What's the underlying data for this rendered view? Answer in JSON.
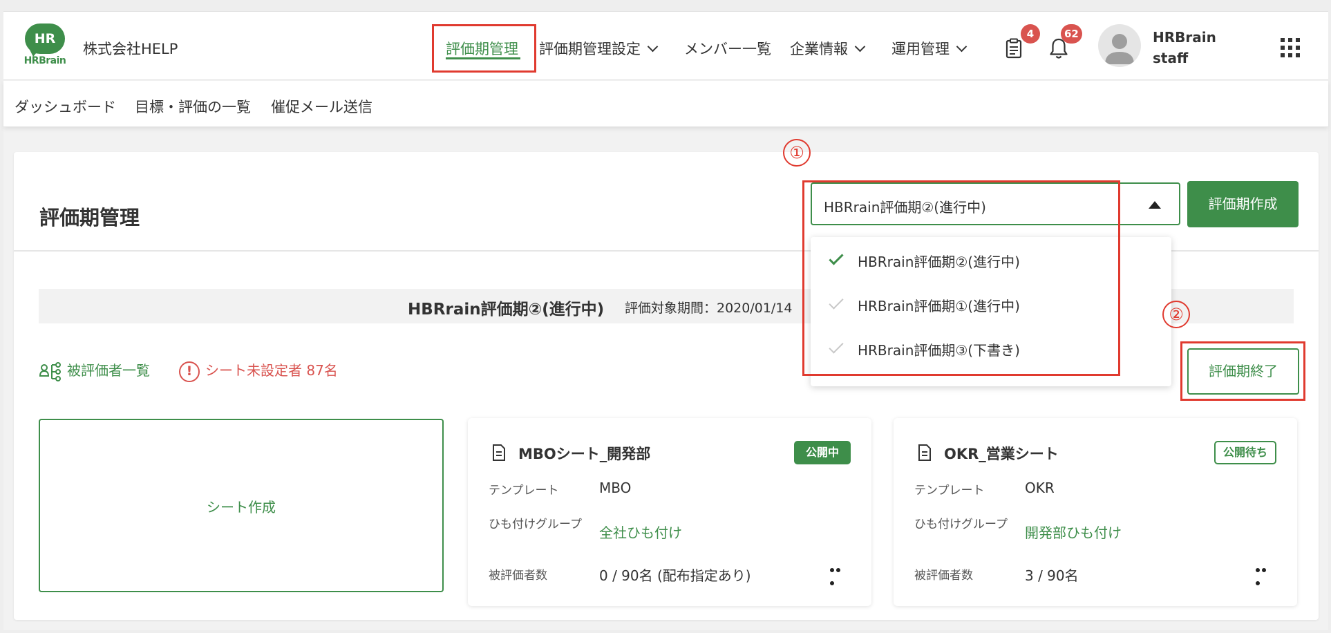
{
  "header": {
    "logo_mark": "HR",
    "logo_text": "HRBrain",
    "company": "株式会社HELP",
    "nav": [
      {
        "label": "評価期管理",
        "active": true
      },
      {
        "label": "評価期管理設定",
        "dropdown": true
      },
      {
        "label": "メンバー一覧"
      },
      {
        "label": "企業情報",
        "dropdown": true
      },
      {
        "label": "運用管理",
        "dropdown": true
      }
    ],
    "tasks_badge": "4",
    "notifications_badge": "62",
    "user_line1": "HRBrain",
    "user_line2": "staff"
  },
  "subnav": {
    "items": [
      "ダッシュボード",
      "目標・評価の一覧",
      "催促メール送信"
    ]
  },
  "main": {
    "title": "評価期管理",
    "select_value": "HBRrain評価期②(進行中)",
    "create_button": "評価期作成",
    "period_name": "HBRrain評価期②(進行中)",
    "period_range": "評価対象期間：2020/01/14",
    "evaluees_link": "被評価者一覧",
    "warning_text": "シート未設定者 87名",
    "end_button": "評価期終了",
    "sheet_create": "シート作成"
  },
  "dropdown": {
    "options": [
      {
        "label": "HBRrain評価期②(進行中)",
        "selected": true
      },
      {
        "label": "HRBrain評価期①(進行中)",
        "selected": false
      },
      {
        "label": "HRBrain評価期③(下書き)",
        "selected": false
      }
    ]
  },
  "sheets": [
    {
      "title": "MBOシート_開発部",
      "status": "公開中",
      "template_label": "テンプレート",
      "template_value": "MBO",
      "group_label": "ひも付けグループ",
      "group_value": "全社ひも付け",
      "count_label": "被評価者数",
      "count_value": "0 / 90名 (配布指定あり)"
    },
    {
      "title": "OKR_営業シート",
      "status": "公開待ち",
      "template_label": "テンプレート",
      "template_value": "OKR",
      "group_label": "ひも付けグループ",
      "group_value": "開発部ひも付け",
      "count_label": "被評価者数",
      "count_value": "3 / 90名"
    }
  ],
  "annotations": {
    "marker_1": "①",
    "marker_2": "②"
  },
  "colors": {
    "brand_green": "#3e8e4a",
    "alert_red": "#d9534f",
    "annotation_red": "#e03a2f"
  }
}
